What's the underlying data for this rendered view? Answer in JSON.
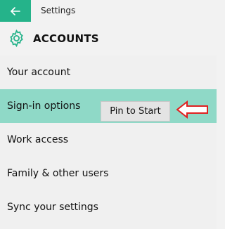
{
  "window": {
    "title": "Settings"
  },
  "header": {
    "title": "ACCOUNTS"
  },
  "nav": {
    "items": [
      {
        "label": "Your account"
      },
      {
        "label": "Sign-in options"
      },
      {
        "label": "Work access"
      },
      {
        "label": "Family & other users"
      },
      {
        "label": "Sync your settings"
      }
    ]
  },
  "context_menu": {
    "pin_label": "Pin to Start"
  },
  "colors": {
    "accent": "#25b38a",
    "selected_item": "#8fd9c7",
    "annotation_arrow": "#e02020"
  },
  "icons": {
    "back": "back-arrow-icon",
    "settings": "gear-icon",
    "annotation": "left-arrow-annotation"
  }
}
